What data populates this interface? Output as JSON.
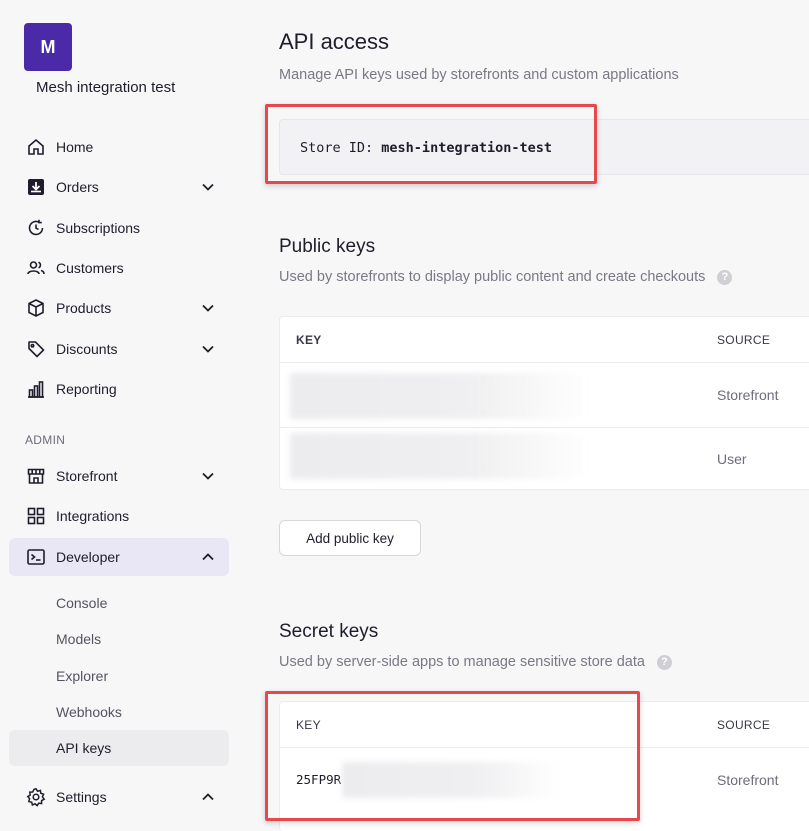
{
  "store": {
    "initial": "M",
    "name": "Mesh integration test"
  },
  "nav": {
    "home": "Home",
    "orders": "Orders",
    "subscriptions": "Subscriptions",
    "customers": "Customers",
    "products": "Products",
    "discounts": "Discounts",
    "reporting": "Reporting",
    "admin_label": "ADMIN",
    "storefront": "Storefront",
    "integrations": "Integrations",
    "developer": "Developer",
    "developer_sub": [
      "Console",
      "Models",
      "Explorer",
      "Webhooks",
      "API keys"
    ],
    "settings": "Settings"
  },
  "page": {
    "title": "API access",
    "subtitle": "Manage API keys used by storefronts and custom applications",
    "store_id_label": "Store ID:",
    "store_id_value": "mesh-integration-test"
  },
  "public_keys": {
    "title": "Public keys",
    "subtitle": "Used by storefronts to display public content and create checkouts",
    "help": "?",
    "col_key": "KEY",
    "col_source": "SOURCE",
    "rows": [
      {
        "source": "Storefront"
      },
      {
        "source": "User"
      }
    ],
    "add_button": "Add public key"
  },
  "secret_keys": {
    "title": "Secret keys",
    "subtitle": "Used by server-side apps to manage sensitive store data",
    "help": "?",
    "col_key": "KEY",
    "col_source": "SOURCE",
    "rows": [
      {
        "key_prefix": "25FP9R",
        "source": "Storefront"
      }
    ]
  },
  "colors": {
    "accent": "#4a2aa6",
    "active_bg": "#e9e7f5",
    "highlight": "#e5484d"
  }
}
